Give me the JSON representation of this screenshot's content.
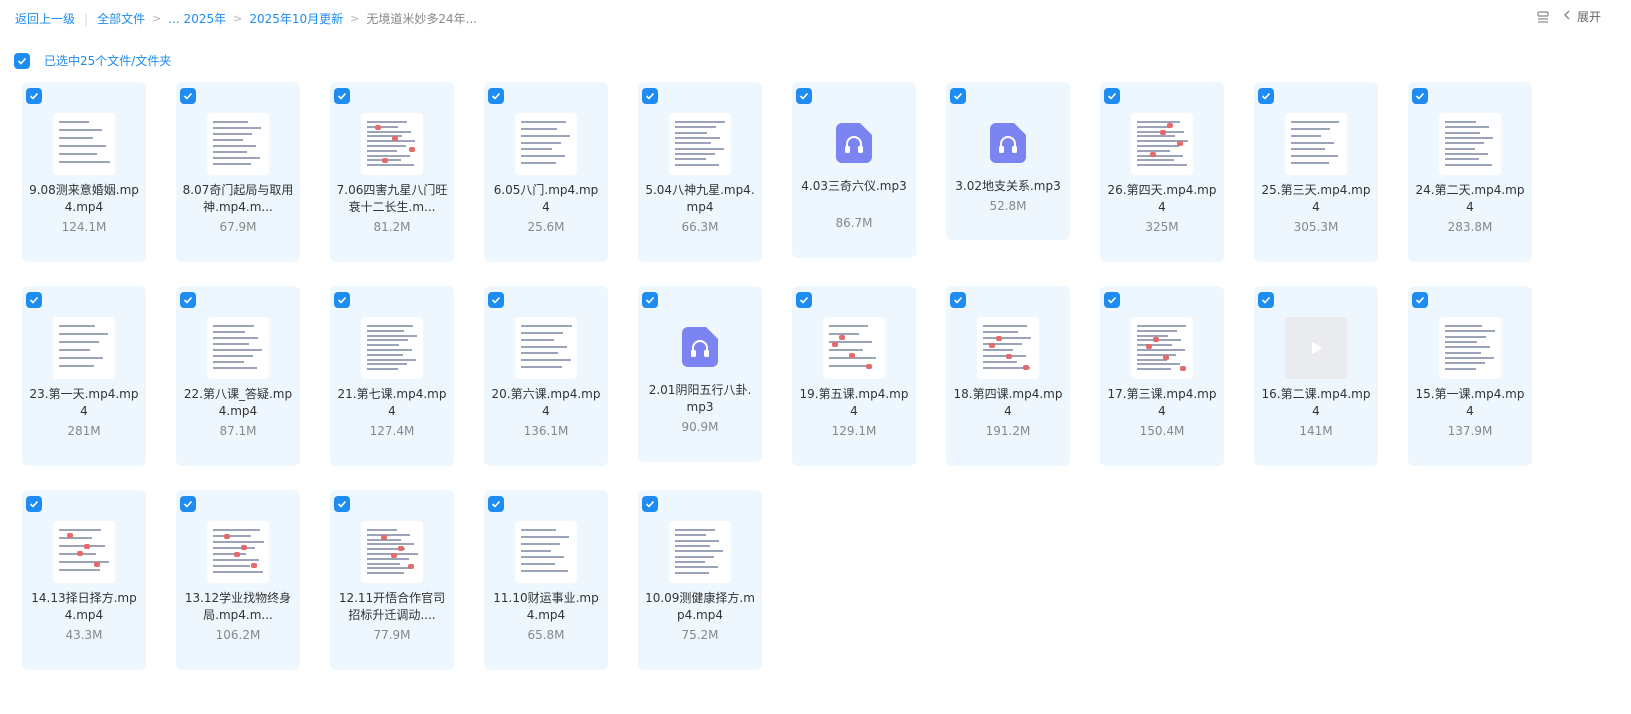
{
  "breadcrumb": {
    "back": "返回上一级",
    "root": "全部文件",
    "ellipsis_folder": "... 2025年",
    "folder": "2025年10月更新",
    "current": "无境道米妙多24年..."
  },
  "toolbar": {
    "expand_label": "展开"
  },
  "selection": {
    "label": "已选中25个文件/文件夹"
  },
  "colors": {
    "accent": "#1e8cf0",
    "card_bg": "#eef7fd",
    "audio": "#7c84f2"
  },
  "files": [
    {
      "name": "9.08测来意婚姻.mp4.mp4",
      "size": "124.1M",
      "type": "video"
    },
    {
      "name": "8.07奇门起局与取用神.mp4.m...",
      "size": "67.9M",
      "type": "video"
    },
    {
      "name": "7.06四害九星八门旺衰十二长生.m...",
      "size": "81.2M",
      "type": "video"
    },
    {
      "name": "6.05八门.mp4.mp4",
      "size": "25.6M",
      "type": "video"
    },
    {
      "name": "5.04八神九星.mp4.mp4",
      "size": "66.3M",
      "type": "video"
    },
    {
      "name": "4.03三奇六仪.mp3",
      "size": "86.7M",
      "type": "audio"
    },
    {
      "name": "3.02地支关系.mp3",
      "size": "52.8M",
      "type": "audio"
    },
    {
      "name": "26.第四天.mp4.mp4",
      "size": "325M",
      "type": "video"
    },
    {
      "name": "25.第三天.mp4.mp4",
      "size": "305.3M",
      "type": "video"
    },
    {
      "name": "24.第二天.mp4.mp4",
      "size": "283.8M",
      "type": "video"
    },
    {
      "name": "23.第一天.mp4.mp4",
      "size": "281M",
      "type": "video"
    },
    {
      "name": "22.第八课_答疑.mp4.mp4",
      "size": "87.1M",
      "type": "video"
    },
    {
      "name": "21.第七课.mp4.mp4",
      "size": "127.4M",
      "type": "video"
    },
    {
      "name": "20.第六课.mp4.mp4",
      "size": "136.1M",
      "type": "video"
    },
    {
      "name": "2.01阴阳五行八卦.mp3",
      "size": "90.9M",
      "type": "audio"
    },
    {
      "name": "19.第五课.mp4.mp4",
      "size": "129.1M",
      "type": "video"
    },
    {
      "name": "18.第四课.mp4.mp4",
      "size": "191.2M",
      "type": "video"
    },
    {
      "name": "17.第三课.mp4.mp4",
      "size": "150.4M",
      "type": "video"
    },
    {
      "name": "16.第二课.mp4.mp4",
      "size": "141M",
      "type": "video"
    },
    {
      "name": "15.第一课.mp4.mp4",
      "size": "137.9M",
      "type": "video"
    },
    {
      "name": "14.13择日择方.mp4.mp4",
      "size": "43.3M",
      "type": "video"
    },
    {
      "name": "13.12学业找物终身局.mp4.m...",
      "size": "106.2M",
      "type": "video"
    },
    {
      "name": "12.11开悟合作官司招标升迁调动....",
      "size": "77.9M",
      "type": "video"
    },
    {
      "name": "11.10财运事业.mp4.mp4",
      "size": "65.8M",
      "type": "video"
    },
    {
      "name": "10.09测健康择方.mp4.mp4",
      "size": "75.2M",
      "type": "video"
    }
  ]
}
